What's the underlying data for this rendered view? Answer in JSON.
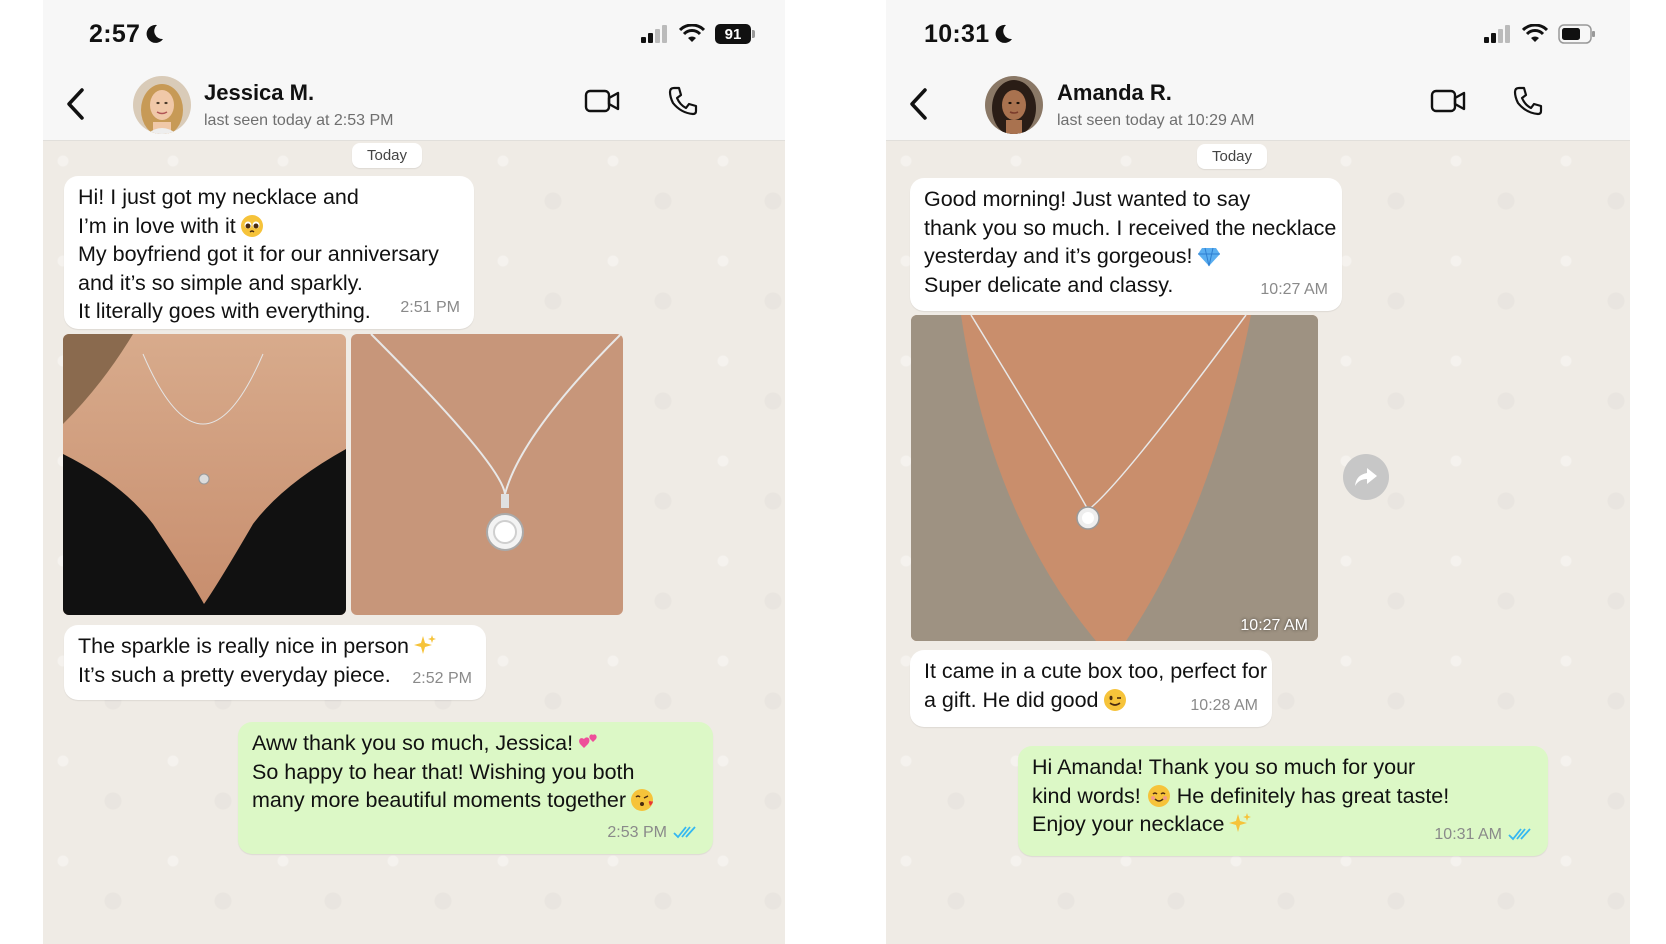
{
  "left": {
    "status_time": "2:57",
    "battery_level": "91",
    "contact_name": "Jessica M.",
    "last_seen": "last seen today at 2:53 PM",
    "date_label": "Today",
    "msg1": {
      "lines": [
        "Hi! I just got my necklace and",
        "I’m in love with it",
        "My boyfriend got it for our anniversary",
        "and it’s so simple and sparkly.",
        "It literally goes with everything."
      ],
      "time": "2:51 PM"
    },
    "msg2": {
      "lines": [
        "The sparkle is really nice in person",
        "It’s such a pretty everyday piece."
      ],
      "time": "2:52 PM"
    },
    "reply": {
      "lines": [
        "Aww thank you so much, Jessica!",
        "So happy to hear that! Wishing you both",
        "many more beautiful moments together"
      ],
      "time": "2:53 PM"
    }
  },
  "right": {
    "status_time": "10:31",
    "contact_name": "Amanda R.",
    "last_seen": "last seen today at 10:29 AM",
    "date_label": "Today",
    "msg1": {
      "lines": [
        "Good morning! Just wanted to say",
        "thank you so much. I received the necklace",
        "yesterday and it’s gorgeous!",
        "Super delicate and classy."
      ],
      "time": "10:27 AM"
    },
    "photo_time": "10:27 AM",
    "msg2": {
      "lines": [
        "It came in a cute box too, perfect for",
        "a gift. He did good"
      ],
      "time": "10:28 AM"
    },
    "reply": {
      "lines": [
        "Hi Amanda! Thank you so much for your",
        "kind words!",
        "He definitely has great taste!",
        "Enjoy your necklace"
      ],
      "time": "10:31 AM"
    }
  },
  "colors": {
    "chat_bg": "#efebe5",
    "incoming_bubble": "#ffffff",
    "outgoing_bubble": "#dcf8c6",
    "read_ticks": "#34b7f1",
    "header_bg": "#f7f7f7"
  },
  "icons": [
    "moon-icon",
    "signal-icon",
    "wifi-icon",
    "battery-icon",
    "back-icon",
    "video-call-icon",
    "phone-call-icon",
    "forward-icon",
    "read-ticks-icon"
  ]
}
